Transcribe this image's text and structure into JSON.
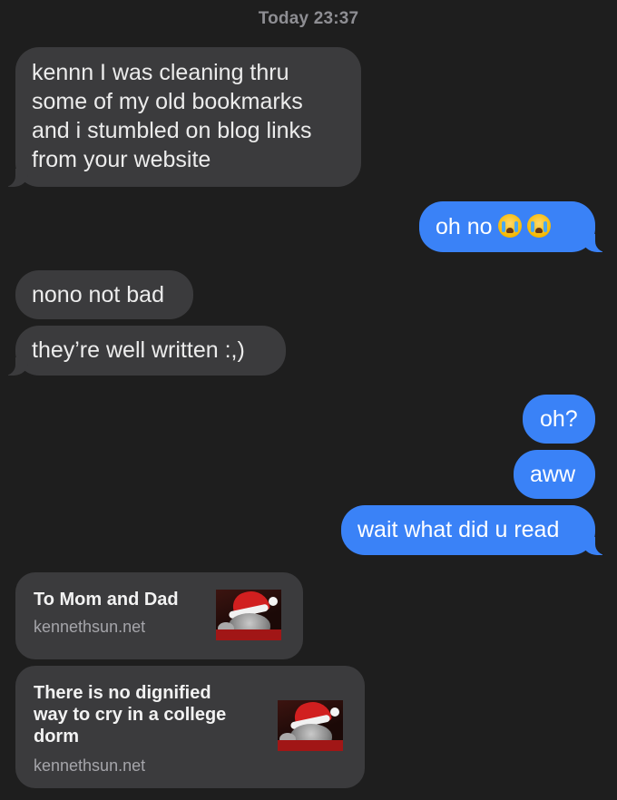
{
  "timestamp": "Today 23:37",
  "messages": [
    {
      "from": "them",
      "lines": [
        "kennn I was cleaning thru",
        "some of my old bookmarks",
        "and i stumbled on blog links",
        "from your website"
      ]
    },
    {
      "from": "me",
      "text": "oh no",
      "emoji": [
        "loudly-crying-face-emoji",
        "loudly-crying-face-emoji"
      ]
    },
    {
      "from": "them",
      "text": "nono not bad"
    },
    {
      "from": "them",
      "text": "they’re well written :,)"
    },
    {
      "from": "me",
      "text": "oh?"
    },
    {
      "from": "me",
      "text": "aww"
    },
    {
      "from": "me",
      "text": "wait what did u read"
    }
  ],
  "links": [
    {
      "title": "To Mom and Dad",
      "domain": "kennethsun.net",
      "thumbnail": "cat-in-santa-hat-image"
    },
    {
      "title_lines": [
        "There is no dignified",
        "way to cry in a college",
        "dorm"
      ],
      "domain": "kennethsun.net",
      "thumbnail": "cat-in-santa-hat-image"
    }
  ],
  "colors": {
    "background": "#1e1e1e",
    "incoming_bubble": "#3b3b3d",
    "outgoing_bubble": "#3a82f7",
    "timestamp": "#8e8e93",
    "link_domain": "#a5a5aa"
  }
}
